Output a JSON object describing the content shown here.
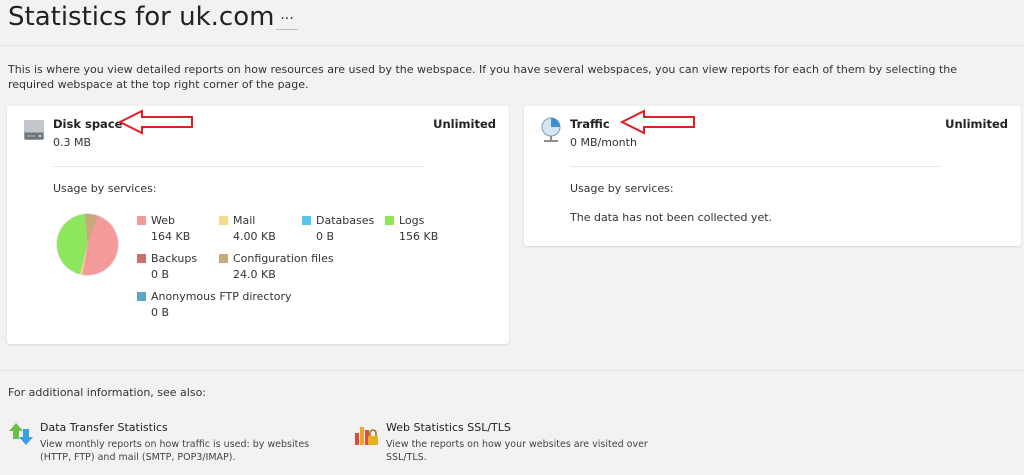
{
  "header": {
    "title": "Statistics for uk.com",
    "more_label": "···"
  },
  "intro": "This is where you view detailed reports on how resources are used by the webspace. If you have several webspaces, you can view reports for each of them by selecting the required webspace at the top right corner of the page.",
  "disk": {
    "title": "Disk space",
    "value": "0.3 MB",
    "limit": "Unlimited",
    "usage_label": "Usage by services:",
    "icon": "hard-drive-icon",
    "services": [
      {
        "name": "Web",
        "value": "164 KB",
        "color": "#f59a9a"
      },
      {
        "name": "Mail",
        "value": "4.00 KB",
        "color": "#f5d98f"
      },
      {
        "name": "Databases",
        "value": "0 B",
        "color": "#58c5ef"
      },
      {
        "name": "Logs",
        "value": "156 KB",
        "color": "#8ee65c"
      },
      {
        "name": "Backups",
        "value": "0 B",
        "color": "#cc6e6e"
      },
      {
        "name": "Configuration files",
        "value": "24.0 KB",
        "color": "#c9a87c"
      },
      {
        "name": "Anonymous FTP directory",
        "value": "0 B",
        "color": "#5aa7c7"
      }
    ],
    "pie_values_kb": [
      164,
      4,
      0,
      156,
      0,
      24,
      0
    ]
  },
  "traffic": {
    "title": "Traffic",
    "value": "0 MB/month",
    "limit": "Unlimited",
    "usage_label": "Usage by services:",
    "no_data": "The data has not been collected yet.",
    "icon": "traffic-globe-icon"
  },
  "see_also": {
    "label": "For additional information, see also:",
    "links": [
      {
        "title": "Data Transfer Statistics",
        "desc": "View monthly reports on how traffic is used: by websites (HTTP, FTP) and mail (SMTP, POP3/IMAP).",
        "icon": "transfer-arrows-icon"
      },
      {
        "title": "Web Statistics SSL/TLS",
        "desc": "View the reports on how your websites are visited over SSL/TLS.",
        "icon": "bar-chart-lock-icon"
      }
    ]
  },
  "annotation_color": "#e01f26"
}
